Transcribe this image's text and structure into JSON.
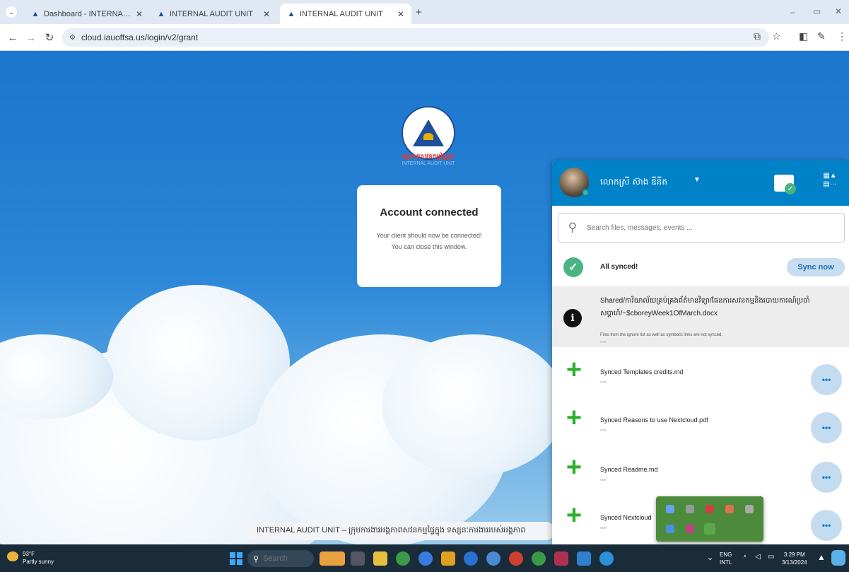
{
  "browser": {
    "tabs": [
      {
        "title": "Dashboard - INTERNAL AUDIT UN"
      },
      {
        "title": "INTERNAL AUDIT UNIT"
      },
      {
        "title": "INTERNAL AUDIT UNIT"
      }
    ],
    "new_tab_label": "+",
    "url": "cloud.iauoffsa.us/login/v2/grant",
    "minimize": "–",
    "restore": "▭",
    "close": "✕"
  },
  "logo": {
    "khmer_text": "អង្គភាពសវនកម្មផ្ទៃក្នុង",
    "english_text": "INTERNAL AUDIT UNIT"
  },
  "card": {
    "title": "Account connected",
    "line1": "Your client should now be connected!",
    "line2": "You can close this window."
  },
  "ticker": {
    "text": "INTERNAL AUDIT UNIT – ក្រុមការងារអង្គភាពសវនកម្មផ្ទៃក្នុង ទស្សនៈការងាររបស់អង្គភាព"
  },
  "panel": {
    "user_name": "លោកស្រី ស៊ាង ឌីនីត",
    "search_placeholder": "Search files, messages, events ...",
    "sync_status": "All synced!",
    "sync_button": "Sync now",
    "warning": {
      "path": "Shared/ការិយាល័យគ្រប់គ្រងព័ត៌មានវិទ្យា/ផែនការសវនកម្មនិងរបាយការណ៍ប្រចាំសប្តាហ៍/~$cboreyWeek1OfMarch.docx",
      "message": "Files from the ignore list as well as symbolic links are not synced.",
      "time": "now"
    },
    "activities": [
      {
        "text": "Synced Templates credits.md",
        "time": "now"
      },
      {
        "text": "Synced Reasons to use Nextcloud.pdf",
        "time": "now"
      },
      {
        "text": "Synced Readme.md",
        "time": "now"
      },
      {
        "text": "Synced Nextcloud",
        "time": "now"
      }
    ],
    "more_label": "•••"
  },
  "taskbar": {
    "temp": "93°F",
    "weather": "Partly sunny",
    "search_placeholder": "Search",
    "lang1": "ENG",
    "lang2": "INTL",
    "time": "3:29 PM",
    "date": "3/13/2024"
  }
}
